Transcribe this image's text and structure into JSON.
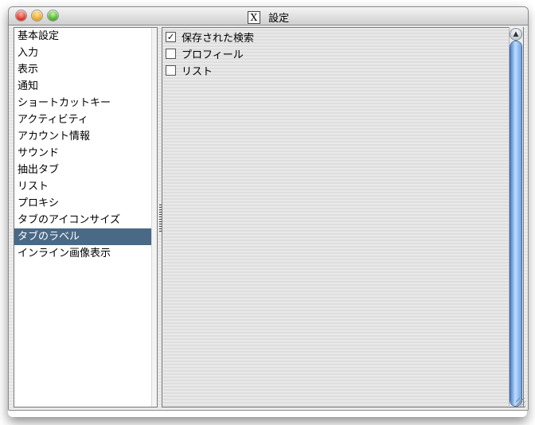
{
  "window": {
    "title": "設定",
    "title_icon": "X"
  },
  "sidebar": {
    "items": [
      {
        "label": "基本設定"
      },
      {
        "label": "入力"
      },
      {
        "label": "表示"
      },
      {
        "label": "通知"
      },
      {
        "label": "ショートカットキー"
      },
      {
        "label": "アクティビティ"
      },
      {
        "label": "アカウント情報"
      },
      {
        "label": "サウンド"
      },
      {
        "label": "抽出タブ"
      },
      {
        "label": "リスト"
      },
      {
        "label": "プロキシ"
      },
      {
        "label": "タブのアイコンサイズ"
      },
      {
        "label": "タブのラベル"
      },
      {
        "label": "インライン画像表示"
      }
    ],
    "selected_label": "タブのラベル",
    "selected_color": "#4a6985"
  },
  "content": {
    "checkboxes": [
      {
        "label": "保存された検索",
        "checked": true,
        "mark": "✓"
      },
      {
        "label": "プロフィール",
        "checked": false,
        "mark": ""
      },
      {
        "label": "リスト",
        "checked": false,
        "mark": ""
      }
    ]
  },
  "scrollbar": {
    "up_arrow": "▲"
  }
}
